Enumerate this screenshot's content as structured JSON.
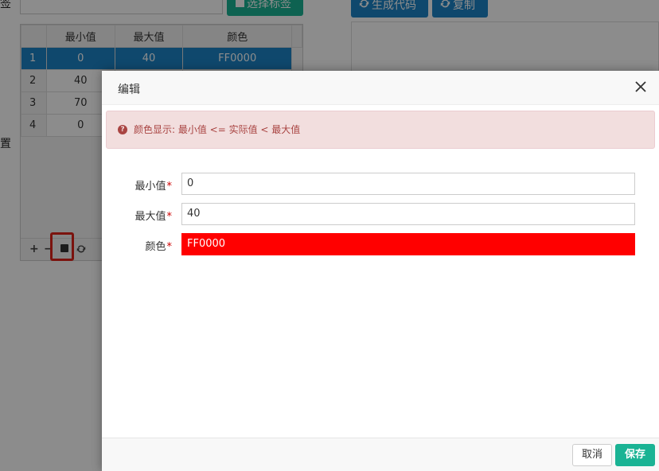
{
  "background": {
    "tag_label": "签",
    "settings_label": "置",
    "choose_tag_button": "选择标签",
    "generate_code_button": "生成代码",
    "copy_button": "复制",
    "grid": {
      "columns": [
        "最小值",
        "最大值",
        "颜色"
      ],
      "rows": [
        {
          "num": "1",
          "min": "0",
          "max": "40",
          "color": "FF0000"
        },
        {
          "num": "2",
          "min": "40",
          "max": "",
          "color": ""
        },
        {
          "num": "3",
          "min": "70",
          "max": "",
          "color": ""
        },
        {
          "num": "4",
          "min": "0",
          "max": "",
          "color": ""
        }
      ],
      "selected_row": "1",
      "pager": {
        "add": "+",
        "remove": "−"
      }
    }
  },
  "dialog": {
    "title": "编辑",
    "close_glyph": "✕",
    "alert_icon": "?",
    "alert_text": "颜色显示: 最小值 <= 实际值 < 最大值",
    "fields": {
      "min": {
        "label": "最小值",
        "value": "0"
      },
      "max": {
        "label": "最大值",
        "value": "40"
      },
      "color": {
        "label": "颜色",
        "value": "FF0000"
      }
    },
    "required_mark": "*",
    "cancel": "取消",
    "save": "保存"
  },
  "colors": {
    "primary_green": "#1ab394",
    "primary_blue": "#1c84c6",
    "color_field": "#ff0000",
    "alert_bg": "#f2dede",
    "alert_text": "#a94442"
  },
  "icons": {
    "refresh": "refresh-icon",
    "file": "file-icon",
    "edit": "edit-icon",
    "help": "question-circle-icon"
  }
}
